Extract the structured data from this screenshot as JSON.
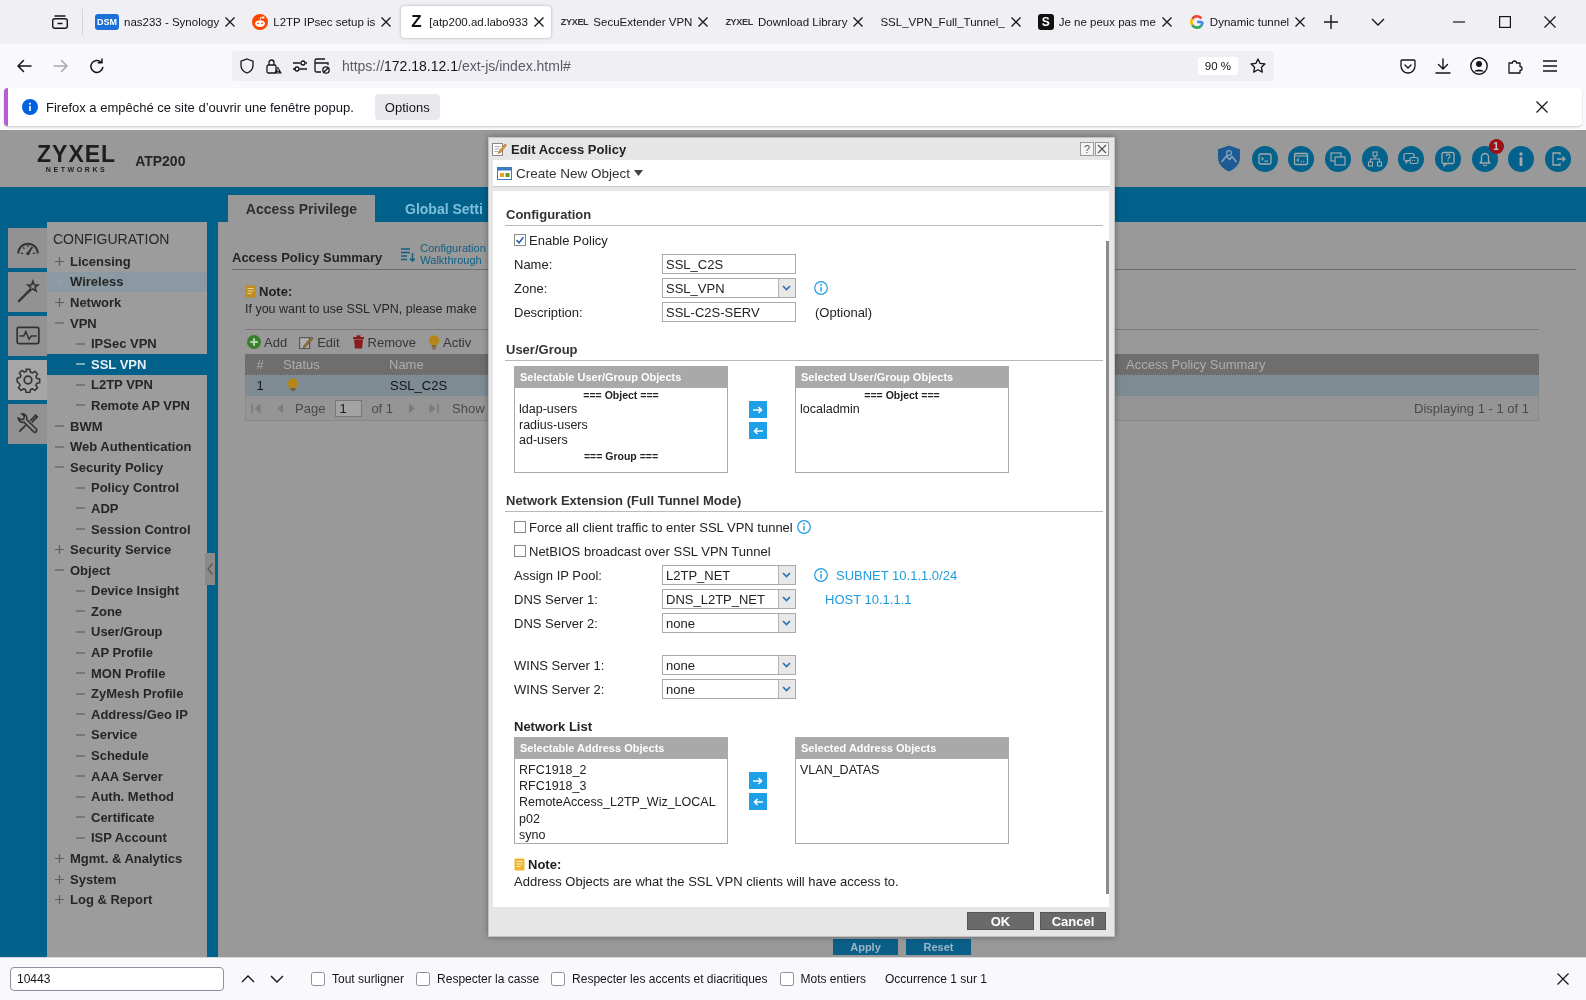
{
  "browser": {
    "tabs": [
      {
        "title": "nas233 - Synology",
        "selected": false,
        "favicon": {
          "kind": "dsm",
          "text": "DSM"
        }
      },
      {
        "title": "L2TP IPsec setup is",
        "selected": false,
        "favicon": {
          "kind": "alien"
        }
      },
      {
        "title": "[atp200.ad.labo933",
        "selected": true,
        "favicon": {
          "kind": "letter",
          "text": "Z"
        }
      },
      {
        "title": "SecuExtender VPN",
        "selected": false,
        "favicon": {
          "kind": "wordmark",
          "text": "ZYXEL"
        }
      },
      {
        "title": "Download Library",
        "selected": false,
        "favicon": {
          "kind": "wordmark",
          "text": "ZYXEL"
        }
      },
      {
        "title": "SSL_VPN_Full_Tunnel_",
        "selected": false
      },
      {
        "title": "Je ne peux pas me",
        "selected": false,
        "favicon": {
          "kind": "tile",
          "text": "S"
        }
      },
      {
        "title": "Dynamic tunnel",
        "selected": false,
        "favicon": {
          "kind": "ring"
        }
      }
    ],
    "url": {
      "scheme": "https://",
      "host": "172.18.12.1",
      "path": "/ext-js/index.html#"
    },
    "zoom": "90 %"
  },
  "notification": {
    "message": "Firefox a empêché ce site d’ouvrir une fenêtre popup.",
    "button": "Options"
  },
  "app": {
    "logo": {
      "name": "ZYXEL",
      "tagline": "NETWORKS"
    },
    "model": "ATP200",
    "notification_count": "1",
    "side_tabs": [
      {
        "selected": false
      },
      {
        "selected": false
      },
      {
        "selected": false
      },
      {
        "selected": true
      },
      {
        "selected": false
      }
    ],
    "menu": {
      "title": "CONFIGURATION",
      "items": [
        {
          "label": "Licensing",
          "collapsed": true,
          "selected": false,
          "hovered": false
        },
        {
          "label": "Wireless",
          "collapsed": true,
          "selected": false,
          "hovered": true
        },
        {
          "label": "Network",
          "collapsed": true,
          "selected": false,
          "hovered": false
        },
        {
          "label": "VPN",
          "collapsed": false,
          "selected": false,
          "hovered": false,
          "children": [
            {
              "label": "IPSec VPN",
              "collapsed": false,
              "selected": false,
              "hovered": false
            },
            {
              "label": "SSL VPN",
              "collapsed": false,
              "selected": true,
              "hovered": false
            },
            {
              "label": "L2TP VPN",
              "collapsed": false,
              "selected": false,
              "hovered": false
            },
            {
              "label": "Remote AP VPN",
              "collapsed": false,
              "selected": false,
              "hovered": false
            }
          ]
        },
        {
          "label": "BWM",
          "collapsed": false,
          "selected": false,
          "hovered": false
        },
        {
          "label": "Web Authentication",
          "collapsed": false,
          "selected": false,
          "hovered": false
        },
        {
          "label": "Security Policy",
          "collapsed": false,
          "selected": false,
          "hovered": false,
          "children": [
            {
              "label": "Policy Control",
              "collapsed": false,
              "selected": false,
              "hovered": false
            },
            {
              "label": "ADP",
              "collapsed": false,
              "selected": false,
              "hovered": false
            },
            {
              "label": "Session Control",
              "collapsed": false,
              "selected": false,
              "hovered": false
            }
          ]
        },
        {
          "label": "Security Service",
          "collapsed": true,
          "selected": false,
          "hovered": false
        },
        {
          "label": "Object",
          "collapsed": false,
          "selected": false,
          "hovered": false,
          "children": [
            {
              "label": "Device Insight",
              "collapsed": false,
              "selected": false,
              "hovered": false
            },
            {
              "label": "Zone",
              "collapsed": false,
              "selected": false,
              "hovered": false
            },
            {
              "label": "User/Group",
              "collapsed": false,
              "selected": false,
              "hovered": false
            },
            {
              "label": "AP Profile",
              "collapsed": false,
              "selected": false,
              "hovered": false
            },
            {
              "label": "MON Profile",
              "collapsed": false,
              "selected": false,
              "hovered": false
            },
            {
              "label": "ZyMesh Profile",
              "collapsed": false,
              "selected": false,
              "hovered": false
            },
            {
              "label": "Address/Geo IP",
              "collapsed": false,
              "selected": false,
              "hovered": false
            },
            {
              "label": "Service",
              "collapsed": false,
              "selected": false,
              "hovered": false
            },
            {
              "label": "Schedule",
              "collapsed": false,
              "selected": false,
              "hovered": false
            },
            {
              "label": "AAA Server",
              "collapsed": false,
              "selected": false,
              "hovered": false
            },
            {
              "label": "Auth. Method",
              "collapsed": false,
              "selected": false,
              "hovered": false
            },
            {
              "label": "Certificate",
              "collapsed": false,
              "selected": false,
              "hovered": false
            },
            {
              "label": "ISP Account",
              "collapsed": false,
              "selected": false,
              "hovered": false
            }
          ]
        },
        {
          "label": "Mgmt. & Analytics",
          "collapsed": true,
          "selected": false,
          "hovered": false
        },
        {
          "label": "System",
          "collapsed": true,
          "selected": false,
          "hovered": false
        },
        {
          "label": "Log & Report",
          "collapsed": true,
          "selected": false,
          "hovered": false
        }
      ]
    },
    "tabs": [
      {
        "label": "Access Privilege",
        "selected": true
      },
      {
        "label": "Global Setti",
        "selected": false
      }
    ],
    "summary": {
      "title": "Access Policy Summary",
      "walkthrough": "Configuration Walkthrough",
      "note": {
        "title": "Note:",
        "text": "If you want to use SSL VPN, please make"
      },
      "toolbar": [
        {
          "kind": "add",
          "label": "Add"
        },
        {
          "kind": "edit",
          "label": "Edit"
        },
        {
          "kind": "remove",
          "label": "Remove"
        },
        {
          "kind": "activate",
          "label": "Activ"
        }
      ],
      "columns": [
        "#",
        "Status",
        "Name",
        "Access Policy Summary"
      ],
      "rows": [
        {
          "number": "1",
          "active": true,
          "name": "SSL_C2S",
          "selected": true
        }
      ],
      "paging": {
        "page_label": "Page",
        "page": "1",
        "total": "of 1",
        "show": "Show",
        "display": "Displaying 1 - 1 of 1"
      },
      "buttons": [
        "Apply",
        "Reset"
      ]
    }
  },
  "dialog": {
    "title": "Edit Access Policy",
    "help": "?",
    "create_menu": "Create New Object",
    "configuration": {
      "heading": "Configuration",
      "enable": {
        "label": "Enable Policy",
        "checked": true
      },
      "fields": [
        {
          "kind": "text",
          "label": "Name:",
          "value": "SSL_C2S"
        },
        {
          "kind": "select",
          "label": "Zone:",
          "value": "SSL_VPN",
          "info": true
        },
        {
          "kind": "text",
          "label": "Description:",
          "value": "SSL-C2S-SERV",
          "hint": "(Optional)"
        }
      ]
    },
    "user_group": {
      "heading": "User/Group",
      "selectable": {
        "title": "Selectable User/Group Objects",
        "entries": [
          {
            "kind": "group",
            "label": "=== Object ==="
          },
          {
            "kind": "item",
            "label": "ldap-users"
          },
          {
            "kind": "item",
            "label": "radius-users"
          },
          {
            "kind": "item",
            "label": "ad-users"
          },
          {
            "kind": "group",
            "label": "=== Group ==="
          }
        ]
      },
      "selected": {
        "title": "Selected User/Group Objects",
        "entries": [
          {
            "kind": "group",
            "label": "=== Object ==="
          },
          {
            "kind": "item",
            "label": "localadmin"
          }
        ]
      }
    },
    "network_extension": {
      "heading": "Network Extension (Full Tunnel Mode)",
      "options": [
        {
          "label": "Force all client traffic to enter SSL VPN tunnel",
          "checked": false,
          "info": true
        },
        {
          "label": "NetBIOS broadcast over SSL VPN Tunnel",
          "checked": false
        }
      ],
      "fields": [
        {
          "kind": "select",
          "label": "Assign IP Pool:",
          "value": "L2TP_NET",
          "info": true,
          "note": "SUBNET 10.1.1.0/24"
        },
        {
          "kind": "select",
          "label": "DNS Server 1:",
          "value": "DNS_L2TP_NET",
          "note": "HOST 10.1.1.1"
        },
        {
          "kind": "select",
          "label": "DNS Server 2:",
          "value": "none"
        }
      ],
      "wins_fields": [
        {
          "kind": "select",
          "label": "WINS Server 1:",
          "value": "none"
        },
        {
          "kind": "select",
          "label": "WINS Server 2:",
          "value": "none"
        }
      ]
    },
    "network_list": {
      "heading": "Network List",
      "selectable": {
        "title": "Selectable Address Objects",
        "entries": [
          {
            "kind": "item",
            "label": "RFC1918_2"
          },
          {
            "kind": "item",
            "label": "RFC1918_3"
          },
          {
            "kind": "item",
            "label": "RemoteAccess_L2TP_Wiz_LOCAL"
          },
          {
            "kind": "item",
            "label": "p02"
          },
          {
            "kind": "item",
            "label": "syno"
          }
        ]
      },
      "selected": {
        "title": "Selected Address Objects",
        "entries": [
          {
            "kind": "item",
            "label": "VLAN_DATAS"
          }
        ]
      }
    },
    "note": {
      "title": "Note:",
      "text": "Address Objects are what the SSL VPN clients will have access to."
    },
    "buttons": [
      {
        "label": "OK"
      },
      {
        "label": "Cancel"
      }
    ]
  },
  "find_bar": {
    "query": "10443",
    "options": [
      {
        "label": "Tout surligner",
        "checked": false
      },
      {
        "label": "Respecter la casse",
        "checked": false
      },
      {
        "label": "Respecter les accents et diacritiques",
        "checked": false
      },
      {
        "label": "Mots entiers",
        "checked": false
      }
    ],
    "status": "Occurrence 1 sur 1"
  }
}
